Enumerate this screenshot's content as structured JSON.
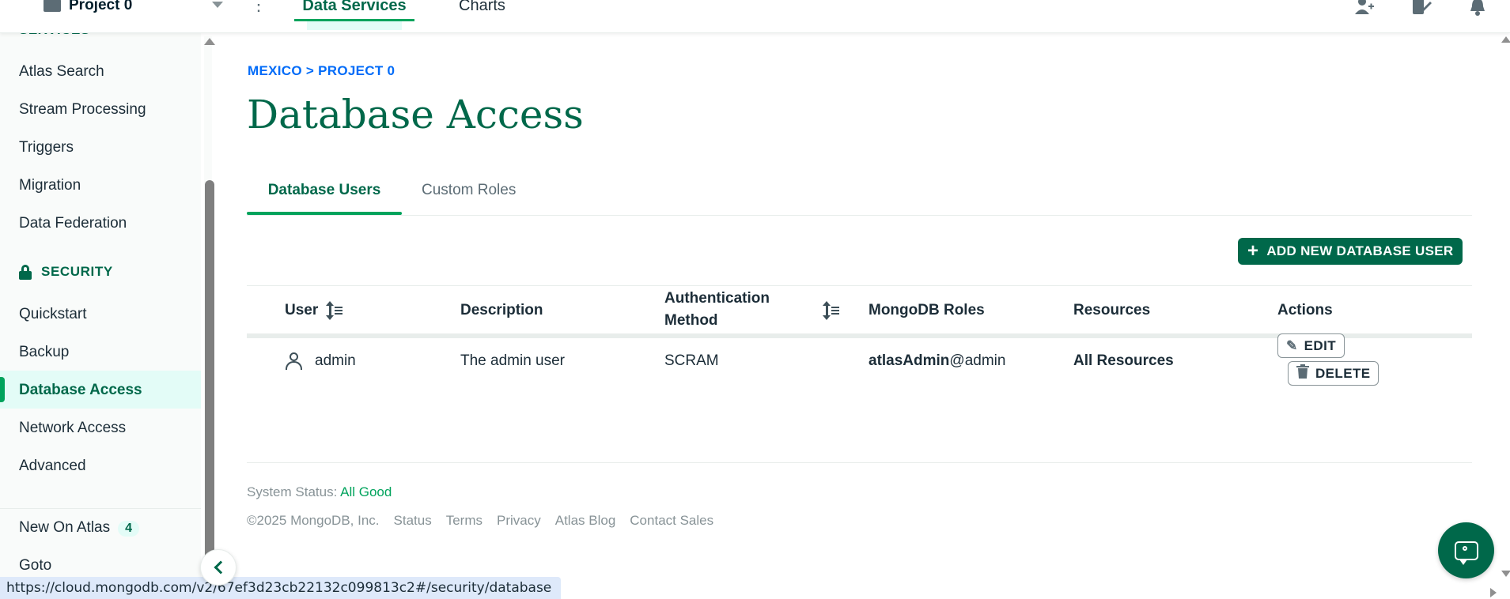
{
  "topbar": {
    "project_name": "Project 0",
    "nav": {
      "data_services": "Data Services",
      "charts": "Charts"
    },
    "icons": [
      "invite-user-icon",
      "edit-activity-icon",
      "bell-icon"
    ]
  },
  "sidebar": {
    "section_cut": "SERVICES",
    "services_items": [
      "Atlas Search",
      "Stream Processing",
      "Triggers",
      "Migration",
      "Data Federation"
    ],
    "security_label": "SECURITY",
    "security_items": [
      "Quickstart",
      "Backup",
      "Database Access",
      "Network Access",
      "Advanced"
    ],
    "active_item": "Database Access",
    "new_on_atlas": {
      "label": "New On Atlas",
      "count": "4"
    },
    "goto": "Goto"
  },
  "main": {
    "breadcrumb": "MEXICO > PROJECT 0",
    "title": "Database Access",
    "tabs": {
      "users": "Database Users",
      "roles": "Custom Roles"
    },
    "add_button": "ADD NEW DATABASE USER",
    "table": {
      "headers": {
        "user": "User",
        "description": "Description",
        "auth_line1": "Authentication",
        "auth_line2": "Method",
        "roles": "MongoDB Roles",
        "resources": "Resources",
        "actions": "Actions"
      },
      "rows": [
        {
          "user": "admin",
          "description": "The admin user",
          "auth": "SCRAM",
          "role_bold": "atlasAdmin",
          "role_db": "@admin",
          "resources": "All Resources",
          "edit": "EDIT",
          "delete": "DELETE"
        }
      ]
    }
  },
  "footer": {
    "status_label": "System Status: ",
    "status_value": "All Good",
    "copyright": "©2025 MongoDB, Inc.",
    "links": [
      "Status",
      "Terms",
      "Privacy",
      "Atlas Blog",
      "Contact Sales"
    ]
  },
  "statusbar": {
    "url": "https://cloud.mongodb.com/v2/67ef3d23cb22132c099813c2#/security/database"
  },
  "colors": {
    "brand_green": "#00684a",
    "accent_green": "#00a35c",
    "link_blue": "#016bf8",
    "active_bg": "#e3fcf7"
  }
}
